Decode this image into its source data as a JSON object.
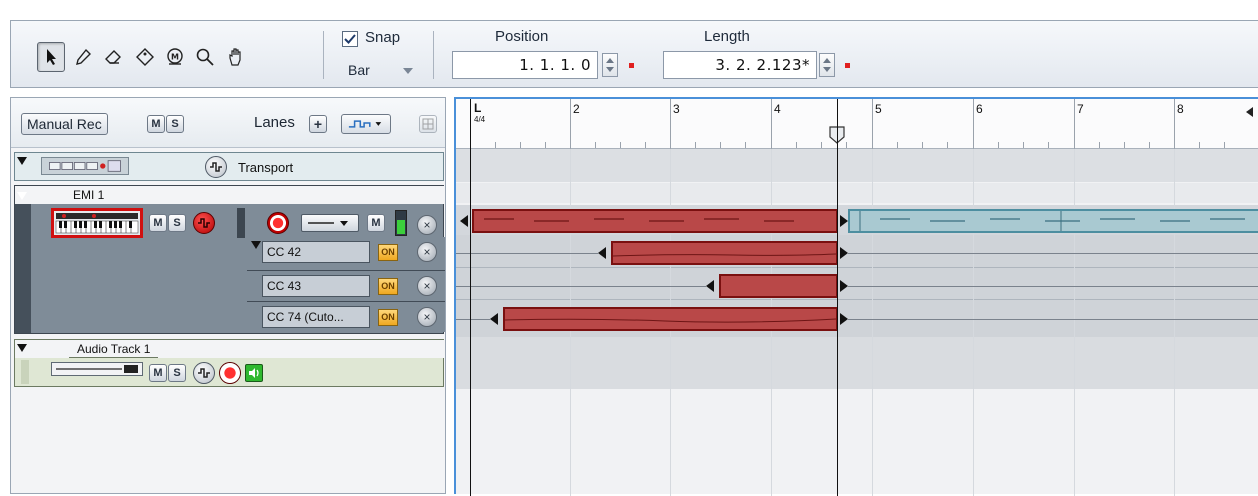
{
  "toolbar": {
    "tools": [
      {
        "name": "pointer-tool",
        "active": true
      },
      {
        "name": "pencil-tool",
        "active": false
      },
      {
        "name": "eraser-tool",
        "active": false
      },
      {
        "name": "paint-tool",
        "active": false
      },
      {
        "name": "mute-tool",
        "active": false
      },
      {
        "name": "zoom-tool",
        "active": false
      },
      {
        "name": "hand-tool",
        "active": false
      }
    ],
    "snap_label": "Snap",
    "snap_checked": true,
    "snap_value": "Bar",
    "position_label": "Position",
    "position_value": "1. 1. 1.   0",
    "length_label": "Length",
    "length_value": "3. 2. 2.123*"
  },
  "track_header": {
    "manual_rec_label": "Manual Rec",
    "mute_label": "M",
    "solo_label": "S",
    "lanes_label": "Lanes",
    "lanes_add": "+"
  },
  "tracks": {
    "transport": {
      "name": "Transport"
    },
    "emi": {
      "name": "EMI 1",
      "mute_label": "M",
      "solo_label": "S",
      "lanes": [
        {
          "name": "CC 42",
          "on_label": "ON"
        },
        {
          "name": "CC 43",
          "on_label": "ON"
        },
        {
          "name": "CC 74 (Cuto...",
          "on_label": "ON"
        }
      ]
    },
    "audio": {
      "name": "Audio Track 1",
      "mute_label": "M",
      "solo_label": "S"
    }
  },
  "ruler": {
    "bars": [
      "",
      "2",
      "3",
      "4",
      "5",
      "6",
      "7",
      "8"
    ],
    "time_signature": "4/4",
    "loop_marker": "L"
  },
  "colors": {
    "selection_blue": "#4a90d9",
    "clip_red": "#b94848",
    "clip_teal": "#a9c9d1",
    "record_red": "#e02020"
  }
}
